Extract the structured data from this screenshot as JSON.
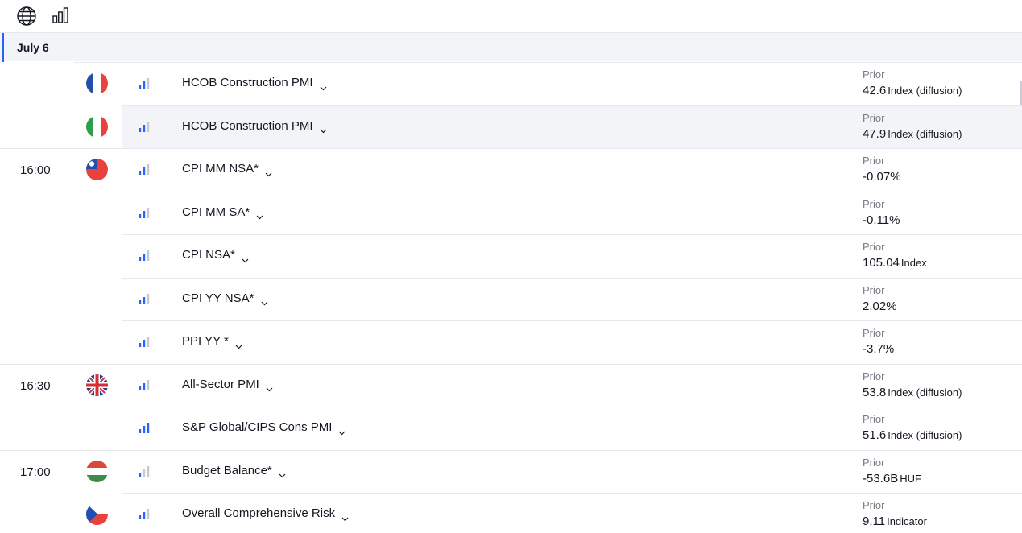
{
  "toolbar": {
    "globe_icon": "globe-icon",
    "chart_icon": "bar-chart-icon"
  },
  "date_label": "July 6",
  "colors": {
    "accent": "#2962ff",
    "highlight": "#f2f4f8",
    "muted": "#787b86"
  },
  "events": [
    {
      "time": "",
      "flag": "france",
      "importance": 1,
      "name": "HCOB Construction PMI",
      "prior_label": "Prior",
      "prior_value": "42.6",
      "prior_unit": "Index (diffusion)"
    },
    {
      "time": "",
      "flag": "italy",
      "importance": 1,
      "name": "HCOB Construction PMI",
      "prior_label": "Prior",
      "prior_value": "47.9",
      "prior_unit": "Index (diffusion)"
    },
    {
      "time": "16:00",
      "flag": "taiwan",
      "importance": 1,
      "name": "CPI MM NSA*",
      "prior_label": "Prior",
      "prior_value": "-0.07%",
      "prior_unit": ""
    },
    {
      "time": "",
      "flag": "",
      "importance": 1,
      "name": "CPI MM SA*",
      "prior_label": "Prior",
      "prior_value": "-0.11%",
      "prior_unit": ""
    },
    {
      "time": "",
      "flag": "",
      "importance": 1,
      "name": "CPI NSA*",
      "prior_label": "Prior",
      "prior_value": "105.04",
      "prior_unit": "Index"
    },
    {
      "time": "",
      "flag": "",
      "importance": 1,
      "name": "CPI YY NSA*",
      "prior_label": "Prior",
      "prior_value": "2.02%",
      "prior_unit": ""
    },
    {
      "time": "",
      "flag": "",
      "importance": 1,
      "name": "PPI YY *",
      "prior_label": "Prior",
      "prior_value": "-3.7%",
      "prior_unit": ""
    },
    {
      "time": "16:30",
      "flag": "uk",
      "importance": 1,
      "name": "All-Sector PMI",
      "prior_label": "Prior",
      "prior_value": "53.8",
      "prior_unit": "Index (diffusion)"
    },
    {
      "time": "",
      "flag": "",
      "importance": 2,
      "name": "S&P Global/CIPS Cons PMI",
      "prior_label": "Prior",
      "prior_value": "51.6",
      "prior_unit": "Index (diffusion)"
    },
    {
      "time": "17:00",
      "flag": "hungary",
      "importance": 0,
      "name": "Budget Balance*",
      "prior_label": "Prior",
      "prior_value": "-53.6B",
      "prior_unit": "HUF"
    },
    {
      "time": "",
      "flag": "czechia",
      "importance": 1,
      "name": "Overall Comprehensive Risk",
      "prior_label": "Prior",
      "prior_value": "9.11",
      "prior_unit": "Indicator"
    }
  ]
}
